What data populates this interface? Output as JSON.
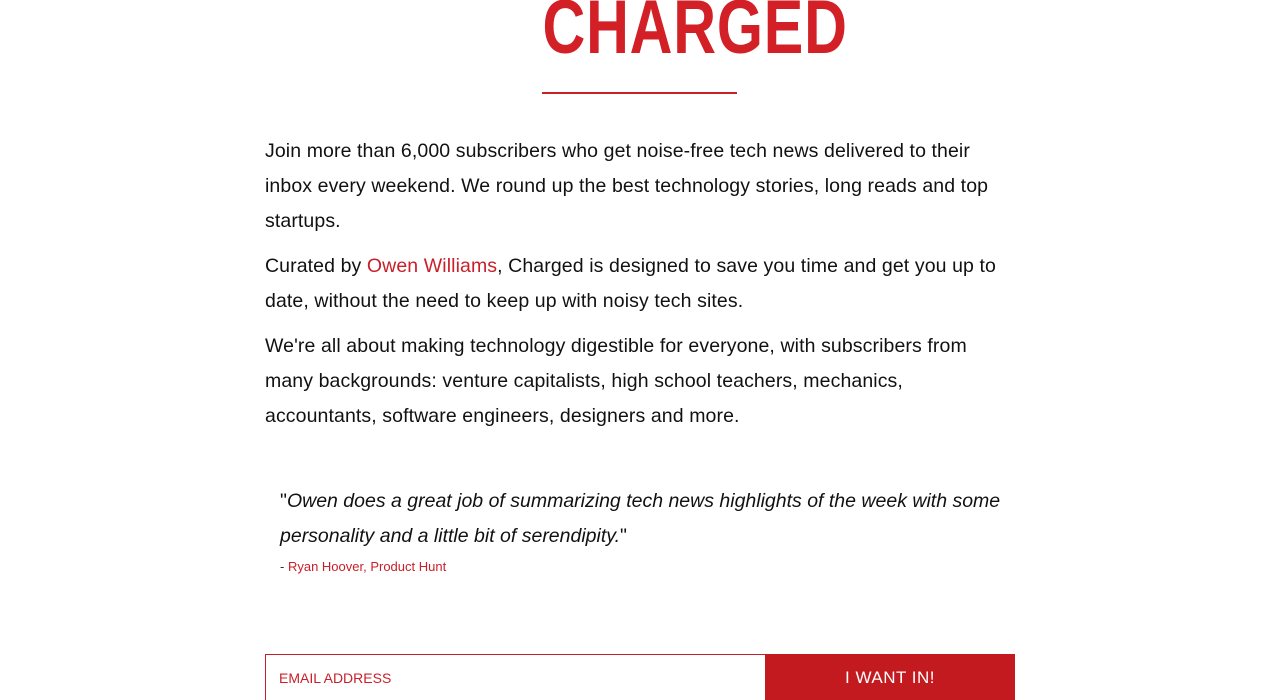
{
  "brand": {
    "logo_text": "CHARGED",
    "accent_color": "#c8202a"
  },
  "intro": {
    "paragraph1": "Join more than 6,000 subscribers who get noise-free tech news delivered to their inbox every weekend. We round up the best technology stories, long reads and top startups.",
    "paragraph2_prefix": "Curated by ",
    "paragraph2_link": "Owen Williams",
    "paragraph2_suffix": ", Charged is designed to save you time and get you up to date, without the need to keep up with noisy tech sites.",
    "paragraph3": "We're all about making technology digestible for everyone, with subscribers from many backgrounds: venture capitalists, high school teachers, mechanics, accountants, software engineers, designers and more."
  },
  "testimonial": {
    "open_quote": "\"",
    "text": "Owen does a great job of summarizing tech news highlights of the week with some personality and a little bit of serendipity.",
    "close_quote": "\"",
    "attribution_prefix": "- ",
    "attribution": "Ryan Hoover, Product Hunt"
  },
  "signup": {
    "email_placeholder": "EMAIL ADDRESS",
    "email_value": "",
    "button_label": "I WANT IN!"
  }
}
